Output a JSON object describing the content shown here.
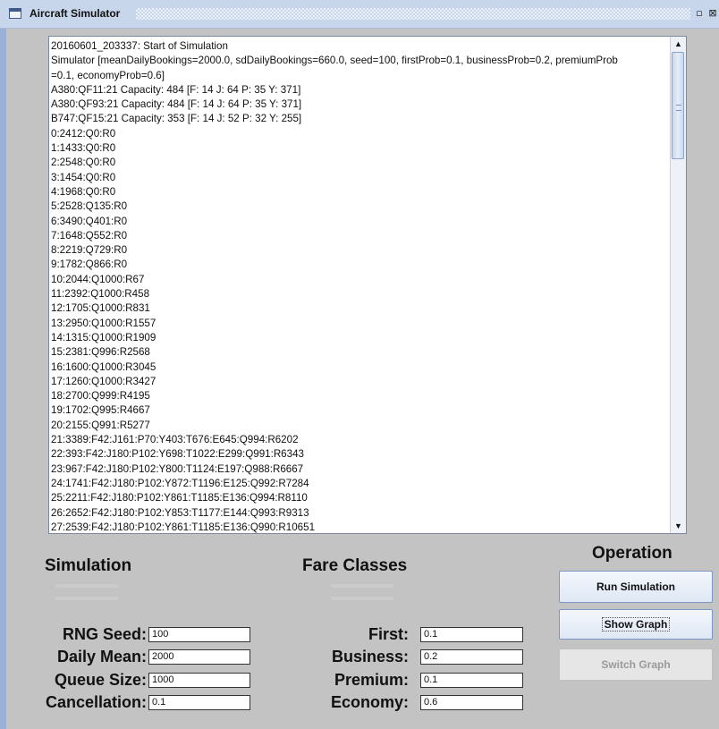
{
  "window": {
    "title": "Aircraft Simulator",
    "restore_glyph": "▫",
    "close_glyph": "⊠"
  },
  "log_lines": [
    "20160601_203337: Start of Simulation",
    "Simulator [meanDailyBookings=2000.0, sdDailyBookings=660.0, seed=100, firstProb=0.1, businessProb=0.2, premiumProb",
    "=0.1, economyProb=0.6]",
    "A380:QF11:21 Capacity: 484 [F: 14 J: 64 P: 35 Y: 371]",
    "A380:QF93:21 Capacity: 484 [F: 14 J: 64 P: 35 Y: 371]",
    "B747:QF15:21 Capacity: 353 [F: 14 J: 52 P: 32 Y: 255]",
    "0:2412:Q0:R0",
    "1:1433:Q0:R0",
    "2:2548:Q0:R0",
    "3:1454:Q0:R0",
    "4:1968:Q0:R0",
    "5:2528:Q135:R0",
    "6:3490:Q401:R0",
    "7:1648:Q552:R0",
    "8:2219:Q729:R0",
    "9:1782:Q866:R0",
    "10:2044:Q1000:R67",
    "11:2392:Q1000:R458",
    "12:1705:Q1000:R831",
    "13:2950:Q1000:R1557",
    "14:1315:Q1000:R1909",
    "15:2381:Q996:R2568",
    "16:1600:Q1000:R3045",
    "17:1260:Q1000:R3427",
    "18:2700:Q999:R4195",
    "19:1702:Q995:R4667",
    "20:2155:Q991:R5277",
    "21:3389:F42:J161:P70:Y403:T676:E645:Q994:R6202",
    "22:393:F42:J180:P102:Y698:T1022:E299:Q991:R6343",
    "23:967:F42:J180:P102:Y800:T1124:E197:Q988:R6667",
    "24:1741:F42:J180:P102:Y872:T1196:E125:Q992:R7284",
    "25:2211:F42:J180:P102:Y861:T1185:E136:Q994:R8110",
    "26:2652:F42:J180:P102:Y853:T1177:E144:Q993:R9313",
    "27:2539:F42:J180:P102:Y861:T1185:E136:Q990:R10651"
  ],
  "scrollbar": {
    "up_icon": "▲",
    "down_icon": "▼"
  },
  "simulation": {
    "title": "Simulation",
    "rng_seed_label": "RNG Seed:",
    "rng_seed_value": "100",
    "daily_mean_label": "Daily Mean:",
    "daily_mean_value": "2000",
    "queue_size_label": "Queue Size:",
    "queue_size_value": "1000",
    "cancellation_label": "Cancellation:",
    "cancellation_value": "0.1"
  },
  "fare_classes": {
    "title": "Fare Classes",
    "first_label": "First:",
    "first_value": "0.1",
    "business_label": "Business:",
    "business_value": "0.2",
    "premium_label": "Premium:",
    "premium_value": "0.1",
    "economy_label": "Economy:",
    "economy_value": "0.6"
  },
  "operation": {
    "title": "Operation",
    "run_label": "Run Simulation",
    "show_graph_label": "Show Graph",
    "switch_graph_label": "Switch Graph"
  }
}
